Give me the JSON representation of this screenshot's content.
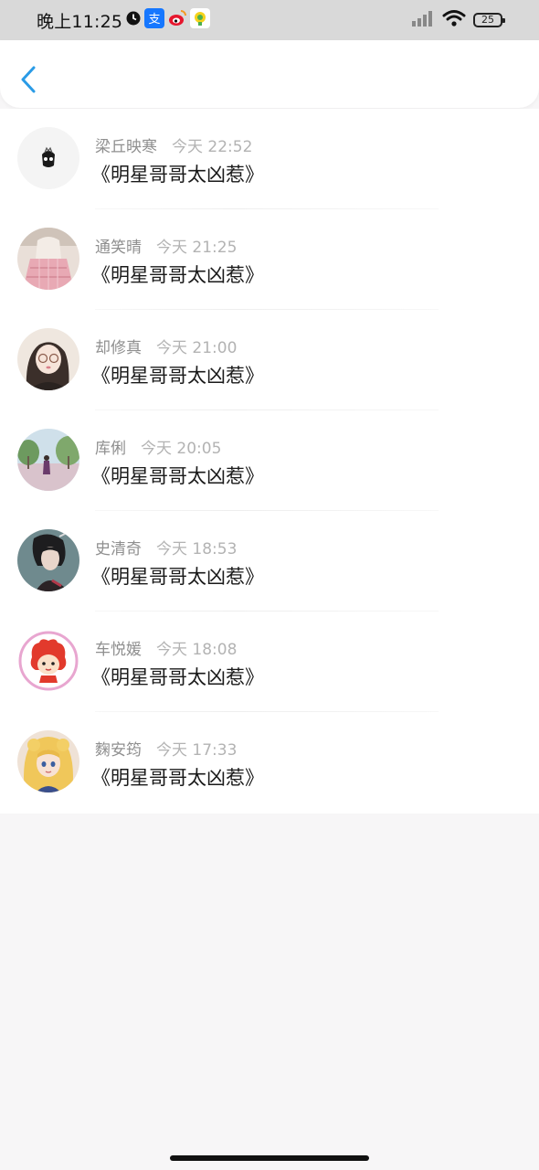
{
  "status_bar": {
    "time": "晚上11:25",
    "battery": "25"
  },
  "messages": [
    {
      "name": "梁丘映寒",
      "time": "今天 22:52",
      "title": "《明星哥哥太凶惹》"
    },
    {
      "name": "通笑晴",
      "time": "今天 21:25",
      "title": "《明星哥哥太凶惹》"
    },
    {
      "name": "却修真",
      "time": "今天 21:00",
      "title": "《明星哥哥太凶惹》"
    },
    {
      "name": "库俐",
      "time": "今天 20:05",
      "title": "《明星哥哥太凶惹》"
    },
    {
      "name": "史清奇",
      "time": "今天 18:53",
      "title": "《明星哥哥太凶惹》"
    },
    {
      "name": "车悦媛",
      "time": "今天 18:08",
      "title": "《明星哥哥太凶惹》"
    },
    {
      "name": "麴安筠",
      "time": "今天 17:33",
      "title": "《明星哥哥太凶惹》"
    }
  ],
  "colors": {
    "accent": "#2a9be6",
    "background": "#f7f6f7"
  }
}
